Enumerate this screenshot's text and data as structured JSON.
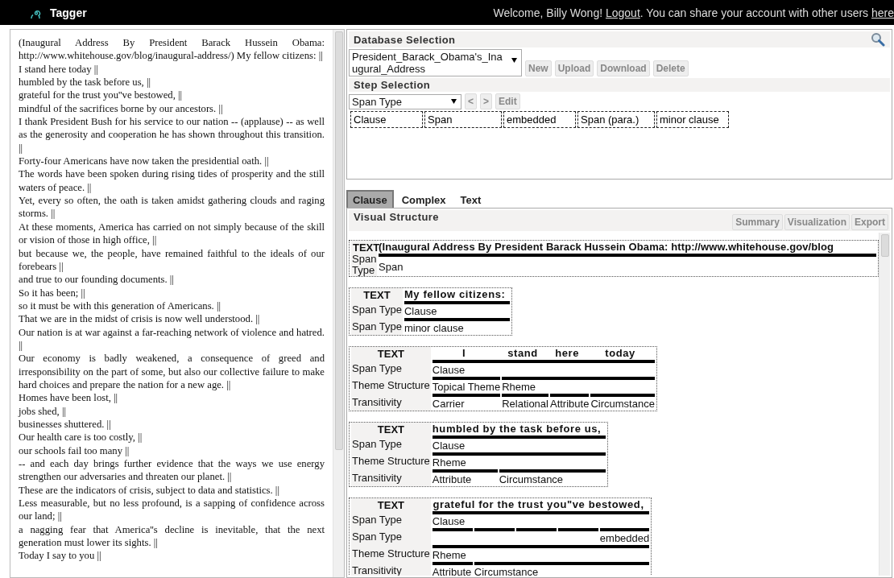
{
  "header": {
    "app_name": "Tagger",
    "welcome": "Welcome, Billy Wong! ",
    "logout": "Logout",
    "share": ". You can share your account with other users ",
    "here": "here"
  },
  "source_text": [
    "(Inaugural Address By President Barack Hussein Obama: http://www.whitehouse.gov/blog/inaugural-address/) My fellow citizens: ||",
    "I stand here today ||",
    "humbled by the task before us,  ||",
    "grateful for the trust you''ve bestowed,  ||",
    "mindful of the sacrifices borne by our ancestors.  ||",
    "I thank President Bush for his service to our nation -- (applause) -- as well as the generosity and cooperation he has shown throughout this transition.  ||",
    "Forty-four Americans have now taken the presidential oath.  ||",
    "The words have been spoken during rising tides of prosperity and the still waters of peace.  ||",
    "Yet, every so often, the oath is taken amidst gathering clouds and raging storms.  ||",
    "At these moments, America has carried on not simply because of the skill or vision of those in high office,  ||",
    "but because we, the people, have remained faithful to the ideals of our forebears  ||",
    "and true to our founding documents. ||",
    "So it has been;  ||",
    "so it must be with this generation of Americans.  ||",
    "That we are in the midst of crisis is now well understood.  ||",
    "Our nation is at war against a far-reaching network of violence and hatred.  ||",
    "Our economy is badly weakened, a consequence of greed and irresponsibility on the part of some, but also our collective failure to make hard choices and prepare the nation for a new age.  ||",
    "Homes have been lost, ||",
    "jobs shed,  ||",
    "businesses shuttered. ||",
    "Our health care is too costly,  ||",
    "our schools fail too many  ||",
    "-- and each day brings further evidence that the ways we use energy strengthen our adversaries and threaten our planet.  ||",
    "These are the indicators of crisis, subject to data and statistics. ||",
    "Less measurable, but no less profound, is a sapping of confidence across our land;  ||",
    "a nagging fear that America''s decline is inevitable, that the next generation must lower its sights.  ||",
    "Today I say to you  ||"
  ],
  "database_selection": {
    "title": "Database Selection",
    "database": "President_Barack_Obama's_Inaugural_Address",
    "buttons": [
      "New",
      "Upload",
      "Download",
      "Delete"
    ]
  },
  "step_selection": {
    "title": "Step Selection",
    "step": "Span Type",
    "buttons": [
      "<",
      ">",
      "Edit"
    ],
    "tags": [
      "Clause",
      "Span",
      "embedded",
      "Span (para.)",
      "minor clause"
    ]
  },
  "tabs": [
    {
      "label": "Clause",
      "selected": true
    },
    {
      "label": "Complex",
      "selected": false
    },
    {
      "label": "Text",
      "selected": false
    }
  ],
  "visual_structure": {
    "title": "Visual Structure",
    "buttons": [
      "Summary",
      "Visualization",
      "Export"
    ],
    "blocks": [
      {
        "label": "TEXT",
        "header": [
          "(Inaugural Address By President Barack Hussein Obama: http://www.whitehouse.gov/blog"
        ],
        "rows": [
          {
            "label": "Span Type",
            "segments": [
              {
                "kind": "label",
                "text": "Span"
              }
            ]
          }
        ]
      },
      {
        "label": "TEXT",
        "header": [
          "My fellow citizens:"
        ],
        "rows": [
          {
            "label": "Span Type",
            "segments": [
              {
                "kind": "label",
                "text": "Clause"
              }
            ]
          },
          {
            "label": "Span Type",
            "segments": [
              {
                "kind": "label",
                "text": "minor clause"
              }
            ]
          }
        ]
      },
      {
        "label": "TEXT",
        "header": [
          "I",
          "stand",
          "here",
          "today"
        ],
        "rows": [
          {
            "label": "Span Type",
            "segments": [
              {
                "kind": "label",
                "text": "Clause"
              }
            ]
          },
          {
            "label": "Theme Structure",
            "segments": [
              {
                "kind": "label",
                "text": "Topical Theme"
              },
              {
                "kind": "label",
                "text": "Rheme"
              }
            ]
          },
          {
            "label": "Transitivity",
            "segments": [
              {
                "kind": "label",
                "text": "Carrier"
              },
              {
                "kind": "label",
                "text": "Relational"
              },
              {
                "kind": "label",
                "text": "Attribute"
              },
              {
                "kind": "label",
                "text": "Circumstance"
              }
            ]
          }
        ]
      },
      {
        "label": "TEXT",
        "header": [
          "humbled by the task before us,"
        ],
        "rows": [
          {
            "label": "Span Type",
            "segments": [
              {
                "kind": "label",
                "text": "Clause"
              }
            ]
          },
          {
            "label": "Theme Structure",
            "segments": [
              {
                "kind": "label",
                "text": "Rheme"
              }
            ]
          },
          {
            "label": "Transitivity",
            "segments": [
              {
                "kind": "label",
                "text": "Attribute"
              },
              {
                "kind": "label",
                "text": "Circumstance"
              }
            ]
          }
        ]
      },
      {
        "label": "TEXT",
        "header": [
          "grateful for the trust you\"ve bestowed,"
        ],
        "rows": [
          {
            "label": "Span Type",
            "segments": [
              {
                "kind": "label",
                "text": "Clause"
              }
            ]
          },
          {
            "label": "Span Type",
            "segments": [
              {
                "kind": "bar"
              },
              {
                "kind": "bar"
              },
              {
                "kind": "bar"
              },
              {
                "kind": "bar"
              },
              {
                "kind": "label",
                "text": "embedded"
              }
            ]
          },
          {
            "label": "Theme Structure",
            "segments": [
              {
                "kind": "label",
                "text": "Rheme"
              }
            ]
          },
          {
            "label": "Transitivity",
            "segments": [
              {
                "kind": "label",
                "text": "Attribute"
              },
              {
                "kind": "label",
                "text": "Circumstance"
              }
            ]
          }
        ]
      }
    ]
  }
}
